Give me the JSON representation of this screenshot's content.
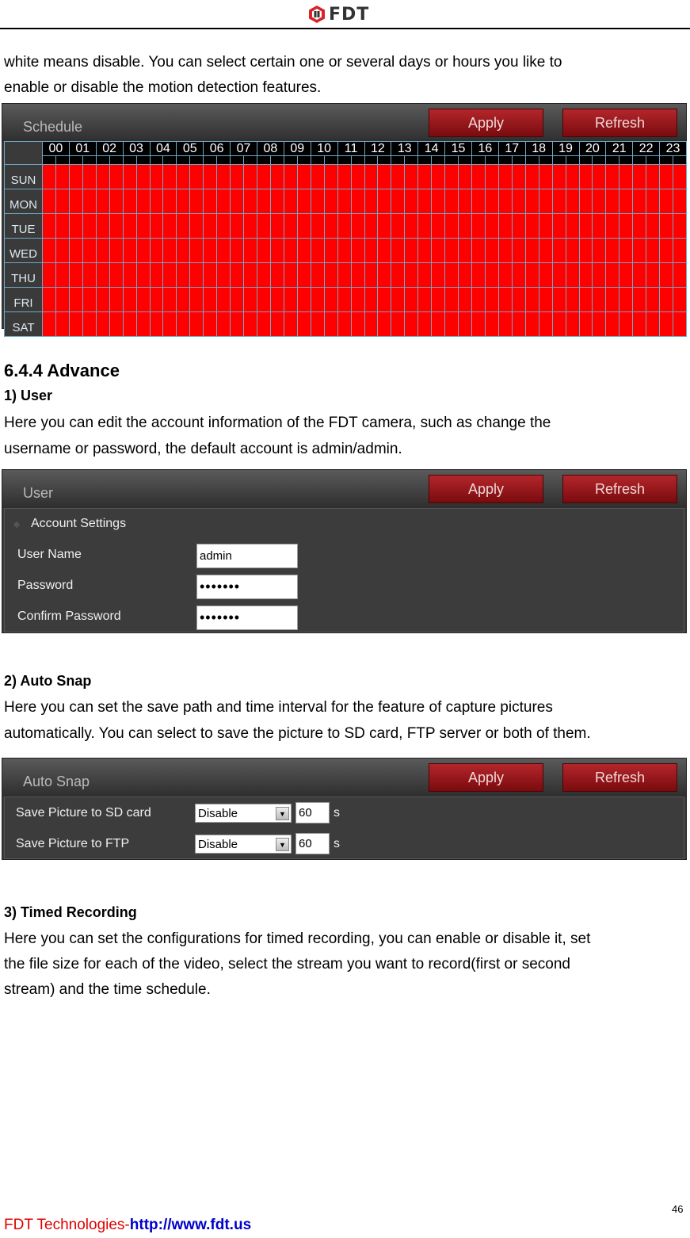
{
  "header": {
    "logo_text": "FDT",
    "logo_icon": "fdt-hexagon-logo-icon"
  },
  "intro_text": [
    "white means disable. You can select certain one or several days or hours you like to",
    "enable or disable the motion detection features."
  ],
  "schedule_panel": {
    "title": "Schedule",
    "apply_label": "Apply",
    "refresh_label": "Refresh",
    "hours": [
      "00",
      "01",
      "02",
      "03",
      "04",
      "05",
      "06",
      "07",
      "08",
      "09",
      "10",
      "11",
      "12",
      "13",
      "14",
      "15",
      "16",
      "17",
      "18",
      "19",
      "20",
      "21",
      "22",
      "23"
    ],
    "days": [
      "SUN",
      "MON",
      "TUE",
      "WED",
      "THU",
      "FRI",
      "SAT"
    ],
    "enabled_color": "#ff0000",
    "all_enabled": true
  },
  "section_title": "6.4.4 Advance",
  "user_section": {
    "heading": "1) User",
    "text": [
      "Here you can edit the account information of the FDT camera, such as change the",
      "username or password, the default account is admin/admin."
    ],
    "panel": {
      "title": "User",
      "apply_label": "Apply",
      "refresh_label": "Refresh",
      "group_label": "Account Settings",
      "fields": [
        {
          "label": "User Name",
          "value": "admin"
        },
        {
          "label": "Password",
          "value": "•••••••"
        },
        {
          "label": "Confirm Password",
          "value": "•••••••"
        }
      ]
    }
  },
  "autosnap_section": {
    "heading": "2) Auto Snap",
    "text": [
      "Here you can set the save path and time interval for the feature of capture pictures",
      "automatically. You can select to save the picture to SD card, FTP server or both of them."
    ],
    "panel": {
      "title": "Auto Snap",
      "apply_label": "Apply",
      "refresh_label": "Refresh",
      "rows": [
        {
          "label": "Save Picture to SD card",
          "select": "Disable",
          "interval": "60",
          "unit": "s"
        },
        {
          "label": "Save Picture to FTP",
          "select": "Disable",
          "interval": "60",
          "unit": "s"
        }
      ]
    }
  },
  "timed_section": {
    "heading": "3) Timed Recording",
    "text": [
      "Here you can set the configurations for timed recording, you can enable or disable it, set",
      "the file size for each of the video, select the stream you want to record(first or second",
      "stream) and the time schedule."
    ]
  },
  "footer": {
    "company": "FDT Technologies-",
    "url": "http://www.fdt.us",
    "page_number": "46"
  }
}
